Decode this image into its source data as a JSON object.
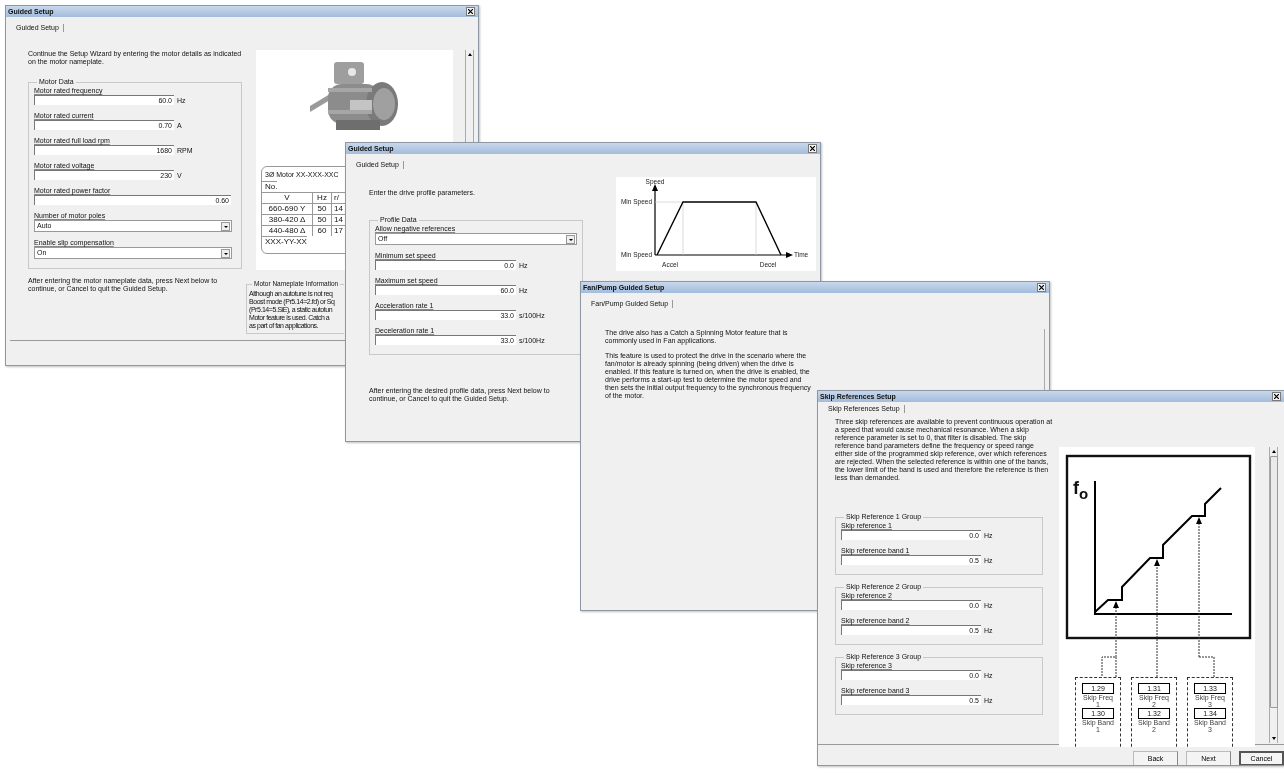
{
  "motor_window": {
    "title": "Guided Setup",
    "tab": {
      "label": "Guided Setup",
      "selected": true
    },
    "intro": "Continue the Setup Wizard by entering the motor details as indicated on the motor nameplate.",
    "group": "Motor Data",
    "fields": [
      {
        "kind": "input",
        "label": "Motor rated frequency",
        "value": "60.0",
        "unit": "Hz"
      },
      {
        "kind": "input",
        "label": "Motor rated current",
        "value": "0.70",
        "unit": "A"
      },
      {
        "kind": "input",
        "label": "Motor rated full load rpm",
        "value": "1680",
        "unit": "RPM"
      },
      {
        "kind": "input",
        "label": "Motor rated voltage",
        "value": "230",
        "unit": "V"
      },
      {
        "kind": "wide",
        "label": "Motor rated power factor",
        "value": "0.60"
      },
      {
        "kind": "select",
        "label": "Number of motor poles",
        "value": "Auto"
      },
      {
        "kind": "select",
        "label": "Enable slip compensation",
        "value": "On"
      }
    ],
    "footer": "After entering the motor nameplate data, press Next below to continue, or Cancel to quit the Guided Setup.",
    "nameplate": {
      "heading": "3Ø Motor XX-XXX-XXC",
      "number_label": "No.",
      "columns": [
        "V",
        "Hz",
        "r/"
      ],
      "rows": [
        [
          "660-690 Y",
          "50",
          "14"
        ],
        [
          "380-420 Δ",
          "50",
          "14"
        ],
        [
          "440-480 Δ",
          "60",
          "17"
        ]
      ],
      "footer": "XXX-YY-XX"
    },
    "info": {
      "title": "Motor Nameplate Information",
      "lines": [
        "Although an autotune is not req",
        "Boost mode (Pr5.14=2.fd) or Sq",
        "(Pr5.14=5.SiE), a static autotun",
        "Motor feature is used.  Catch a",
        "as part of fan applications."
      ]
    }
  },
  "profile_window": {
    "title": "Guided Setup",
    "tab": {
      "label": "Guided Setup",
      "selected": true
    },
    "intro": "Enter the drive profile parameters.",
    "group": "Profile Data",
    "fields": [
      {
        "kind": "select",
        "label": "Allow negative references",
        "value": "Off"
      },
      {
        "kind": "input",
        "label": "Minimum set speed",
        "value": "0.0",
        "unit": "Hz"
      },
      {
        "kind": "input",
        "label": "Maximum set speed",
        "value": "60.0",
        "unit": "Hz"
      },
      {
        "kind": "input",
        "label": "Acceleration rate 1",
        "value": "33.0",
        "unit": "s/100Hz"
      },
      {
        "kind": "input",
        "label": "Deceleration rate 1",
        "value": "33.0",
        "unit": "s/100Hz"
      }
    ],
    "footer": "After entering the desired profile data, press Next below to continue, or Cancel to quit the Guided Setup.",
    "diagram": {
      "y_axis": "Speed",
      "top_level": "Min Speed",
      "bottom_level": "Min Speed",
      "accel": "Accel",
      "decel": "Decel",
      "x_axis": "Time"
    }
  },
  "fan_window": {
    "title": "Fan/Pump Guided Setup",
    "tab": {
      "label": "Fan/Pump Guided Setup",
      "selected": true
    },
    "paragraphs": [
      "The drive also has a Catch a Spinning Motor feature that is commonly used in Fan applications.",
      "This feature is used to protect the drive in the scenario where the fan/motor is already spinning (being driven) when the drive is enabled.  If this feature is turned on, when the drive is enabled, the drive performs a start-up test to determine the motor speed and then sets the initial output frequency to the synchronous frequency of the motor."
    ]
  },
  "skip_window": {
    "title": "Skip References Setup",
    "tab": {
      "label": "Skip References Setup",
      "selected": true
    },
    "intro": "Three skip references are available to prevent continuous operation at a speed that would cause mechanical resonance.  When a skip reference parameter is set to 0, that filter is disabled.  The skip reference band parameters define the frequency or speed range either side of the programmed skip reference, over which references are rejected.  When the selected reference is within one of the bands, the lower limit of the band is used and therefore the reference is then less than demanded.",
    "groups": [
      {
        "title": "Skip Reference 1 Group",
        "fields": [
          {
            "label": "Skip reference 1",
            "value": "0.0",
            "unit": "Hz"
          },
          {
            "label": "Skip reference band 1",
            "value": "0.5",
            "unit": "Hz"
          }
        ]
      },
      {
        "title": "Skip Reference 2 Group",
        "fields": [
          {
            "label": "Skip reference 2",
            "value": "0.0",
            "unit": "Hz"
          },
          {
            "label": "Skip reference band 2",
            "value": "0.5",
            "unit": "Hz"
          }
        ]
      },
      {
        "title": "Skip Reference 3 Group",
        "fields": [
          {
            "label": "Skip reference 3",
            "value": "0.0",
            "unit": "Hz"
          },
          {
            "label": "Skip reference band 3",
            "value": "0.5",
            "unit": "Hz"
          }
        ]
      }
    ],
    "diagram": {
      "axis_label": "f$_{o}$",
      "blocks": [
        {
          "freq_code": "1.29",
          "freq_label": "Skip Freq",
          "freq_index": "1",
          "band_code": "1.30",
          "band_label": "Skip Band",
          "band_index": "1"
        },
        {
          "freq_code": "1.31",
          "freq_label": "Skip Freq",
          "freq_index": "2",
          "band_code": "1.32",
          "band_label": "Skip Band",
          "band_index": "2"
        },
        {
          "freq_code": "1.33",
          "freq_label": "Skip Freq",
          "freq_index": "3",
          "band_code": "1.34",
          "band_label": "Skip Band",
          "band_index": "3"
        }
      ]
    },
    "buttons": [
      {
        "label": "Back",
        "focused": false
      },
      {
        "label": "Next",
        "focused": false
      },
      {
        "label": "Cancel",
        "focused": true
      }
    ]
  }
}
